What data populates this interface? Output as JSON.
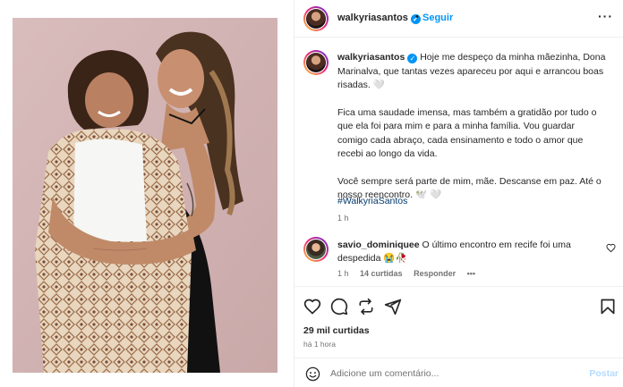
{
  "header": {
    "username": "walkyriasantos",
    "verified_glyph": "✓",
    "separator": "•",
    "follow_label": "Seguir",
    "more_glyph": "···"
  },
  "caption": {
    "username": "walkyriasantos",
    "paragraph1": "Hoje me despeço da minha mãezinha, Dona Marinalva, que tantas vezes apareceu por aqui e arrancou boas risadas. 🤍",
    "paragraph2": "Fica uma saudade imensa, mas também a gratidão por tudo o que ela foi para mim e para a minha família. Vou guardar comigo cada abraço, cada ensinamento e todo o amor que recebi ao longo da vida.",
    "paragraph3": "Você sempre será parte de mim, mãe. Descanse em paz. Até o nosso reencontro. 🕊️ 🤍",
    "hashtag": "#WalkyriaSantos",
    "time": "1 h"
  },
  "comment": {
    "username": "savio_dominiquee",
    "text": "O último encontro em recife foi uma despedida 😭🥀",
    "time": "1 h",
    "likes": "14 curtidas",
    "reply_label": "Responder",
    "more_glyph": "•••"
  },
  "post": {
    "likes": "29 mil curtidas",
    "time": "há 1 hora"
  },
  "add_comment": {
    "placeholder": "Adicione um comentário...",
    "post_label": "Postar"
  },
  "icons": {
    "like": "heart-icon",
    "comment": "comment-icon",
    "share": "share-icon",
    "save": "bookmark-icon",
    "emoji": "emoji-icon"
  },
  "colors": {
    "accent": "#0095f6",
    "hashtag": "#00376b",
    "muted": "#737373",
    "post_disabled": "#b3dbff"
  }
}
